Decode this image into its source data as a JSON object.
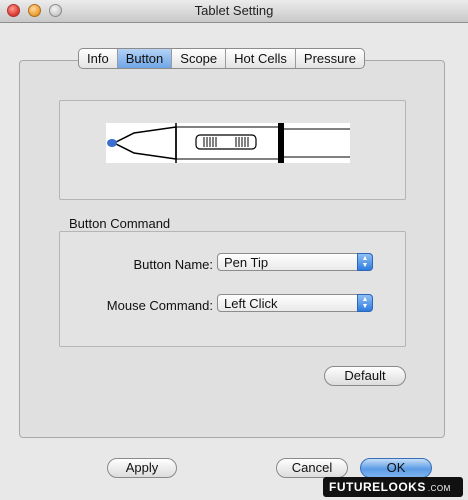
{
  "window": {
    "title": "Tablet Setting"
  },
  "tabs": [
    {
      "label": "Info"
    },
    {
      "label": "Button"
    },
    {
      "label": "Scope"
    },
    {
      "label": "Hot Cells"
    },
    {
      "label": "Pressure"
    }
  ],
  "active_tab": "Button",
  "button_command": {
    "group_label": "Button Command",
    "button_name_label": "Button Name:",
    "button_name_value": "Pen Tip",
    "mouse_command_label": "Mouse Command:",
    "mouse_command_value": "Left Click"
  },
  "buttons": {
    "default": "Default",
    "apply": "Apply",
    "cancel": "Cancel",
    "ok": "OK"
  },
  "watermark": {
    "text": "FUTURELOOKS",
    "domain": ".COM"
  },
  "colors": {
    "accent": "#5c9ce6",
    "pen_tip": "#3a6fd0"
  }
}
